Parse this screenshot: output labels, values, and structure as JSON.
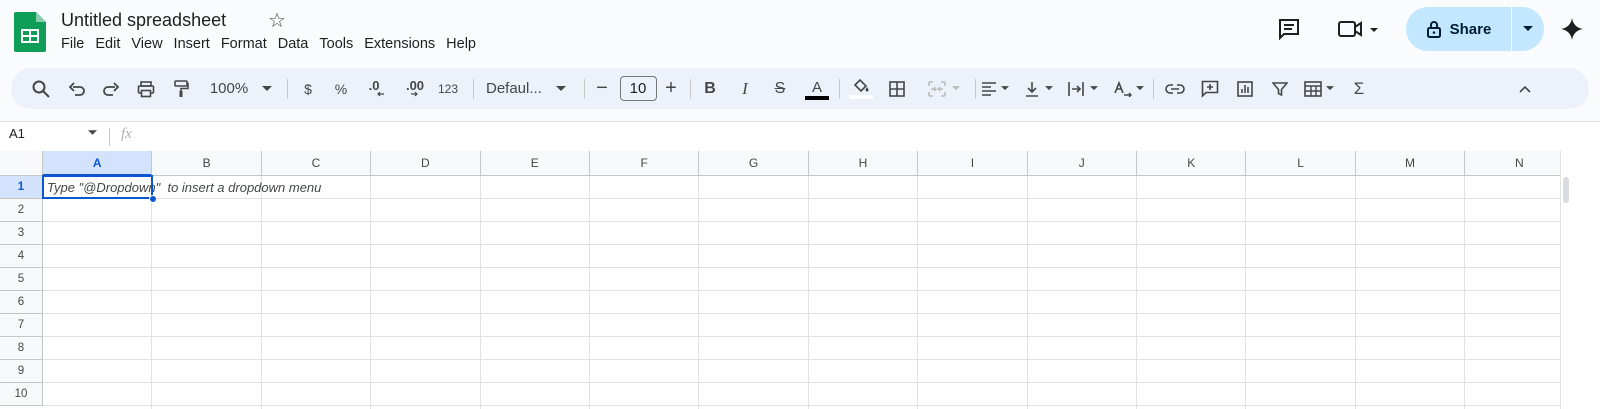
{
  "app": {
    "title": "Untitled spreadsheet",
    "menu": [
      "File",
      "Edit",
      "View",
      "Insert",
      "Format",
      "Data",
      "Tools",
      "Extensions",
      "Help"
    ],
    "share_label": "Share"
  },
  "toolbar": {
    "zoom": "100%",
    "currency": "$",
    "percent": "%",
    "decimal_decrease": ".0",
    "decimal_increase": ".00",
    "number_format": "123",
    "font": "Defaul...",
    "font_size": "10",
    "minus": "−",
    "plus": "+",
    "bold": "B",
    "italic": "I",
    "strike": "S",
    "text_color": "A",
    "sum": "Σ"
  },
  "formula_bar": {
    "name_box": "A1",
    "fx": "fx"
  },
  "grid": {
    "columns": [
      "A",
      "B",
      "C",
      "D",
      "E",
      "F",
      "G",
      "H",
      "I",
      "J",
      "K",
      "L",
      "M",
      "N"
    ],
    "rows": [
      "1",
      "2",
      "3",
      "4",
      "5",
      "6",
      "7",
      "8",
      "9",
      "10"
    ],
    "selected_cell": "A1",
    "hint": "Type \"@Dropdown\"  to insert a dropdown menu"
  },
  "colors": {
    "accent": "#0b57d0",
    "share_bg": "#c2e7ff",
    "sheets_green": "#0f9d58"
  }
}
